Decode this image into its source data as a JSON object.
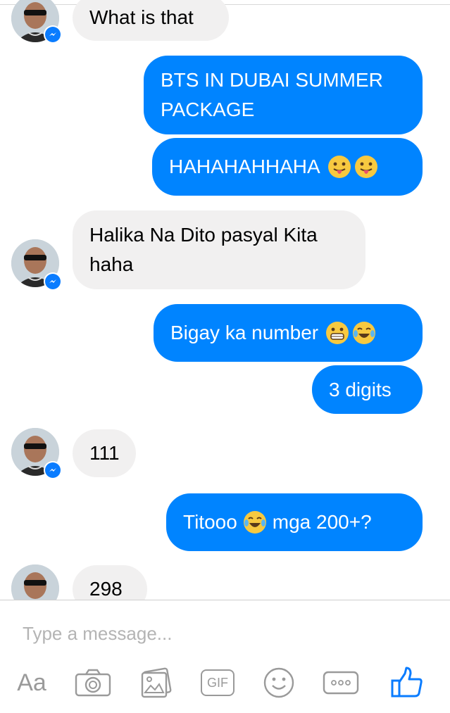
{
  "messages": [
    {
      "from": "them",
      "text": "What is that"
    },
    {
      "from": "me",
      "text": "BTS IN DUBAI SUMMER PACKAGE"
    },
    {
      "from": "me",
      "text": "HAHAHAHHAHA"
    },
    {
      "from": "them",
      "text": "Halika Na Dito pasyal Kita haha"
    },
    {
      "from": "me",
      "text": "Bigay ka number"
    },
    {
      "from": "me",
      "text": "3 digits"
    },
    {
      "from": "them",
      "text": "111"
    },
    {
      "from": "me",
      "text_before": "Titooo",
      "text_after": "mga 200+?"
    },
    {
      "from": "them",
      "text": "298"
    }
  ],
  "composer": {
    "placeholder": "Type a message..."
  },
  "toolbar": {
    "text_label": "Aa",
    "gif_label": "GIF"
  },
  "colors": {
    "outgoing": "#0084ff",
    "incoming": "#f1f0f0",
    "messenger_badge": "#0a7cff",
    "like": "#0a7cff"
  },
  "icons": [
    "camera-icon",
    "photo-icon",
    "gif-icon",
    "emoji-icon",
    "more-icon",
    "thumbs-up-icon",
    "messenger-badge-icon"
  ]
}
